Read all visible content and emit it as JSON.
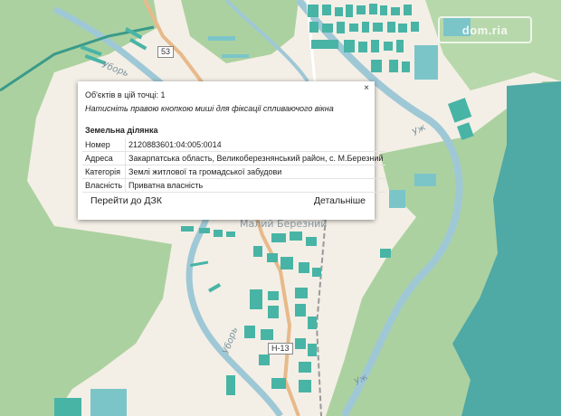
{
  "map": {
    "road_label": "Н-13",
    "road_label_top": "53",
    "river_names": [
      "Уборь",
      "Уж",
      "Уборь",
      "Уж"
    ],
    "place_name": "Малий Березний",
    "watermark": "dom.ria",
    "colors": {
      "forest": "#acd1a0",
      "open": "#f3efe6",
      "water": "#4fa9a5",
      "river": "#9fc8d6",
      "parcel": "#48b4a6",
      "parcel_light": "#7bc5c9"
    }
  },
  "popup": {
    "close_label": "×",
    "objects_count": "Об'єктів в цій точці: 1",
    "hint": "Натисніть правою кнопкою миші для фіксації спливаючого вікна",
    "section_title": "Земельна ділянка",
    "rows": [
      {
        "key": "Номер",
        "value": "2120883601:04:005:0014"
      },
      {
        "key": "Адреса",
        "value": "Закарпатська область, Великоберезнянський район, с. М.Березний"
      },
      {
        "key": "Категорія",
        "value": "Землі житлової та громадської забудови"
      },
      {
        "key": "Власність",
        "value": "Приватна власність"
      }
    ],
    "link_dzk": "Перейти до ДЗК",
    "link_details": "Детальніше"
  }
}
